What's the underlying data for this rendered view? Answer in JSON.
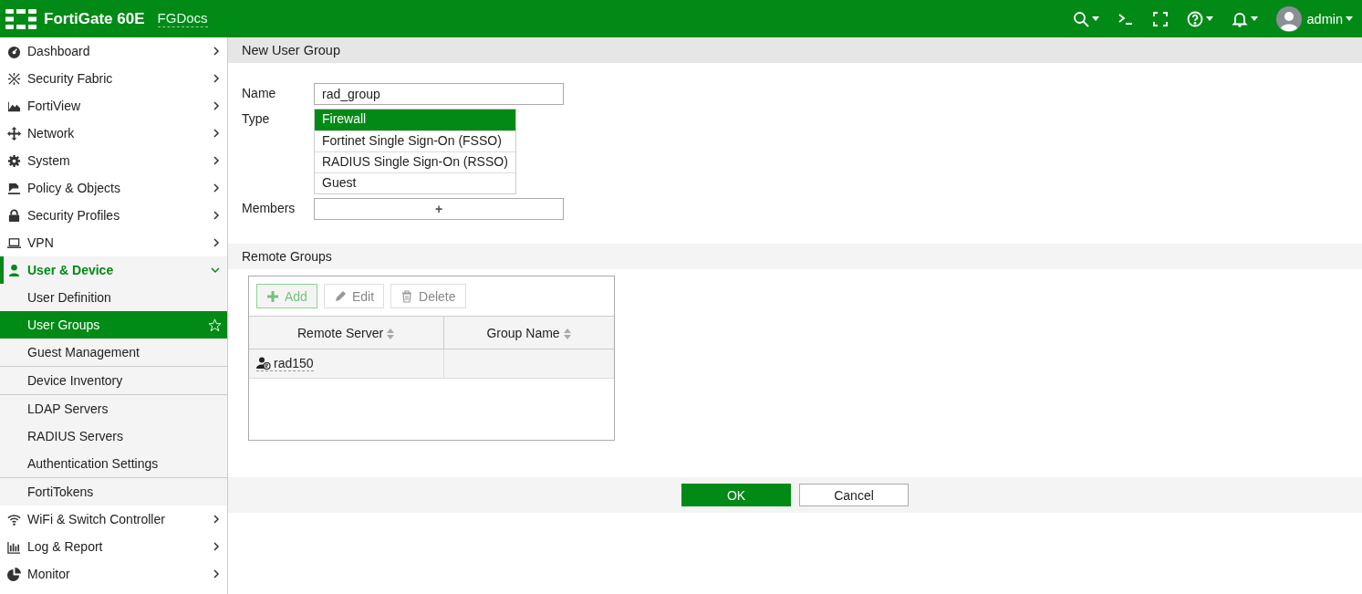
{
  "header": {
    "product": "FortiGate 60E",
    "hostname": "FGDocs",
    "user": "admin"
  },
  "sidebar": {
    "items": [
      {
        "label": "Dashboard",
        "expanded": false,
        "selected": false
      },
      {
        "label": "Security Fabric",
        "expanded": false,
        "selected": false
      },
      {
        "label": "FortiView",
        "expanded": false,
        "selected": false
      },
      {
        "label": "Network",
        "expanded": false,
        "selected": false
      },
      {
        "label": "System",
        "expanded": false,
        "selected": false
      },
      {
        "label": "Policy & Objects",
        "expanded": false,
        "selected": false
      },
      {
        "label": "Security Profiles",
        "expanded": false,
        "selected": false
      },
      {
        "label": "VPN",
        "expanded": false,
        "selected": false
      },
      {
        "label": "User & Device",
        "expanded": true,
        "selected": true,
        "children": [
          {
            "label": "User Definition",
            "selected": false,
            "favorite": false,
            "section_end": false
          },
          {
            "label": "User Groups",
            "selected": true,
            "favorite": true,
            "section_end": false
          },
          {
            "label": "Guest Management",
            "selected": false,
            "favorite": false,
            "section_end": true
          },
          {
            "label": "Device Inventory",
            "selected": false,
            "favorite": false,
            "section_end": true
          },
          {
            "label": "LDAP Servers",
            "selected": false,
            "favorite": false,
            "section_end": false
          },
          {
            "label": "RADIUS Servers",
            "selected": false,
            "favorite": false,
            "section_end": false
          },
          {
            "label": "Authentication Settings",
            "selected": false,
            "favorite": false,
            "section_end": true
          },
          {
            "label": "FortiTokens",
            "selected": false,
            "favorite": false,
            "section_end": false
          }
        ]
      },
      {
        "label": "WiFi & Switch Controller",
        "expanded": false,
        "selected": false
      },
      {
        "label": "Log & Report",
        "expanded": false,
        "selected": false
      },
      {
        "label": "Monitor",
        "expanded": false,
        "selected": false
      }
    ]
  },
  "page_title": "New User Group",
  "form": {
    "name_label": "Name",
    "name_value": "rad_group",
    "type_label": "Type",
    "type_options": [
      {
        "label": "Firewall",
        "selected": true
      },
      {
        "label": "Fortinet Single Sign-On (FSSO)",
        "selected": false
      },
      {
        "label": "RADIUS Single Sign-On (RSSO)",
        "selected": false
      },
      {
        "label": "Guest",
        "selected": false
      }
    ],
    "members_label": "Members",
    "members_add": "+"
  },
  "remote_groups": {
    "title": "Remote Groups",
    "toolbar": [
      {
        "label": "Add",
        "disabled": false
      },
      {
        "label": "Edit",
        "disabled": true
      },
      {
        "label": "Delete",
        "disabled": true
      }
    ],
    "columns": [
      "Remote Server",
      "Group Name"
    ],
    "rows": [
      [
        "rad150",
        ""
      ]
    ]
  },
  "buttons": {
    "ok": "OK",
    "cancel": "Cancel"
  }
}
